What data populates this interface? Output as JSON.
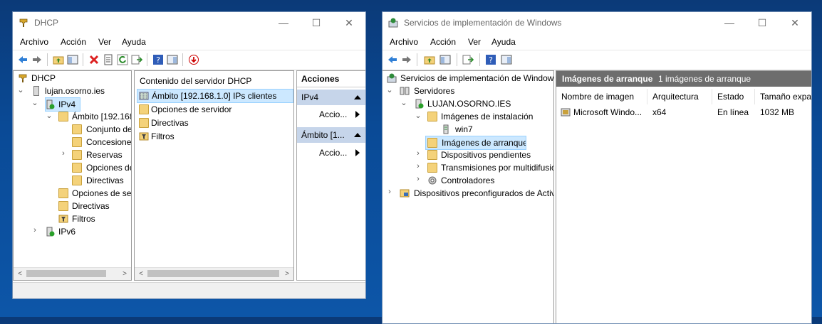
{
  "dhcp": {
    "title": "DHCP",
    "controls": {
      "minimize": "—",
      "maximize": "☐",
      "close": "✕"
    },
    "menu": [
      "Archivo",
      "Acción",
      "Ver",
      "Ayuda"
    ],
    "tree": [
      {
        "label": "DHCP"
      },
      {
        "label": "lujan.osorno.ies"
      },
      {
        "label": "IPv4"
      },
      {
        "label": "Ámbito [192.168"
      },
      {
        "label": "Conjunto de"
      },
      {
        "label": "Concesiones"
      },
      {
        "label": "Reservas"
      },
      {
        "label": "Opciones de"
      },
      {
        "label": "Directivas"
      },
      {
        "label": "Opciones de se"
      },
      {
        "label": "Directivas"
      },
      {
        "label": "Filtros"
      },
      {
        "label": "IPv6"
      }
    ],
    "content_header": "Contenido del servidor DHCP",
    "content_items": [
      "Ámbito [192.168.1.0] IPs clientes",
      "Opciones de servidor",
      "Directivas",
      "Filtros"
    ],
    "actions": {
      "header": "Acciones",
      "group1": "IPv4",
      "item1": "Accio...",
      "group2": "Ámbito [1...",
      "item2": "Accio..."
    }
  },
  "wds": {
    "title": "Servicios de implementación de Windows",
    "controls": {
      "minimize": "—",
      "maximize": "☐",
      "close": "✕"
    },
    "menu": [
      "Archivo",
      "Acción",
      "Ver",
      "Ayuda"
    ],
    "tree": [
      {
        "label": "Servicios de implementación de Windows"
      },
      {
        "label": "Servidores"
      },
      {
        "label": "LUJAN.OSORNO.IES"
      },
      {
        "label": "Imágenes de instalación"
      },
      {
        "label": "win7"
      },
      {
        "label": "Imágenes de arranque"
      },
      {
        "label": "Dispositivos pendientes"
      },
      {
        "label": "Transmisiones por multidifusión"
      },
      {
        "label": "Controladores"
      },
      {
        "label": "Dispositivos preconfigurados de Active Directory"
      }
    ],
    "pane_title": "Imágenes de arranque",
    "pane_count": "1 imágenes de arranque",
    "columns": [
      "Nombre de imagen",
      "Arquitectura",
      "Estado",
      "Tamaño expa"
    ],
    "rows": [
      {
        "name": "Microsoft Windo...",
        "arch": "x64",
        "state": "En línea",
        "size": "1032 MB"
      }
    ]
  },
  "colors": {
    "selection": "#cce8ff",
    "actions_band": "#c6d5ea",
    "pane_header": "#6d6d6d",
    "desktop": "#0a4a96"
  }
}
